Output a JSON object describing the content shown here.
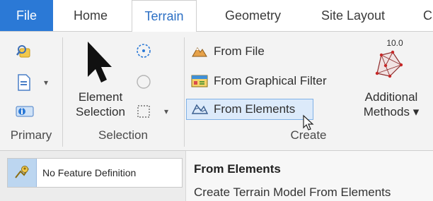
{
  "tabs": {
    "file": "File",
    "home": "Home",
    "terrain": "Terrain",
    "geometry": "Geometry",
    "site_layout": "Site Layout",
    "more": "C"
  },
  "ribbon": {
    "groups": {
      "primary": "Primary",
      "selection": "Selection",
      "create": "Create"
    },
    "selection": {
      "element_selection_line1": "Element",
      "element_selection_line2": "Selection"
    },
    "create": {
      "from_file": "From File",
      "from_graphical_filter": "From Graphical Filter",
      "from_elements": "From Elements",
      "additional_methods_line1": "Additional",
      "additional_methods_line2": "Methods ▾",
      "additional_methods_badge": "10.0"
    },
    "dropdown_arrow": "▾"
  },
  "feature_definition": {
    "value": "No Feature Definition"
  },
  "tooltip": {
    "title": "From Elements",
    "description": "Create Terrain Model From Elements"
  },
  "colors": {
    "file_tab": "#2b79d6",
    "active_tab_text": "#2b6fc4",
    "active_button_border": "#7fb1e6",
    "active_button_fill": "#dceafa"
  }
}
